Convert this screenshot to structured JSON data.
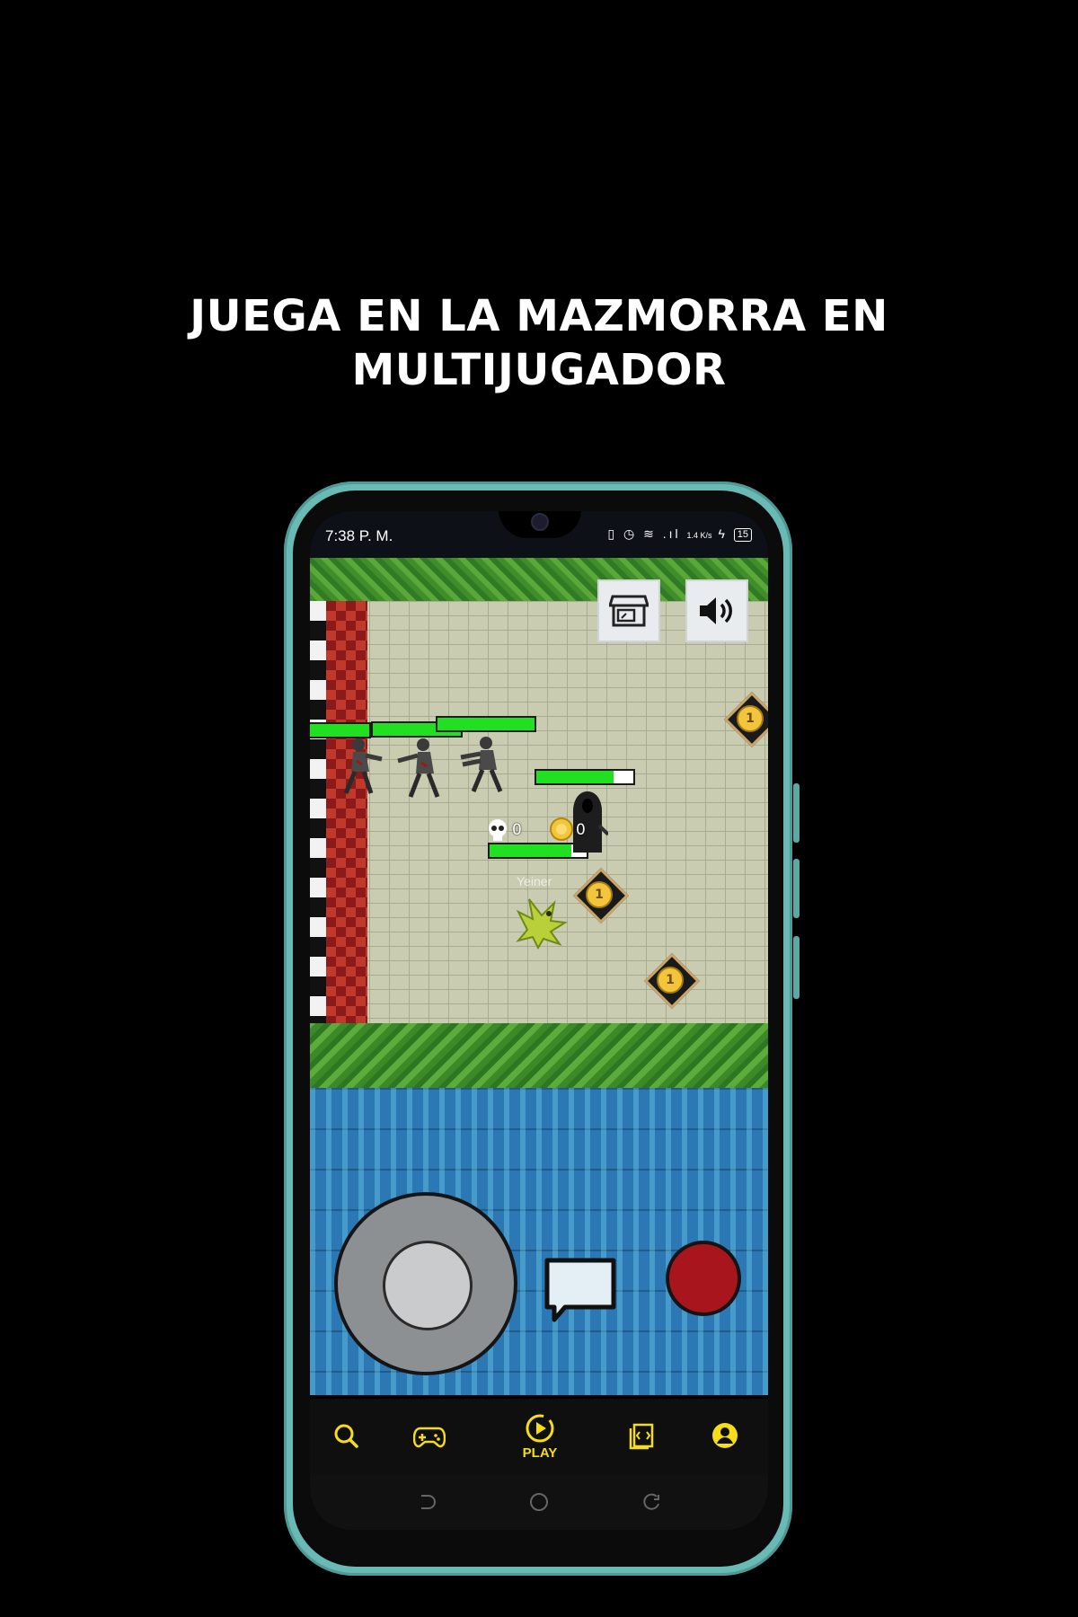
{
  "headline": {
    "line1": "JUEGA EN LA MAZMORRA EN",
    "line2": "MULTIJUGADOR"
  },
  "status_bar": {
    "time": "7:38 P. M.",
    "speed": "1.4 K/s",
    "battery": "15"
  },
  "game": {
    "buttons": {
      "shop_icon": "shop-icon",
      "sound_icon": "speaker-icon"
    },
    "hud_counters": {
      "kills": "0",
      "coins": "0"
    },
    "player_name": "Yeiner",
    "coin_label": "1",
    "health": {
      "zombie_1": 1.0,
      "zombie_2": 1.0,
      "zombie_3": 1.0,
      "reaper": 0.8,
      "player": 0.84
    }
  },
  "nav": {
    "items": [
      {
        "icon": "search-icon",
        "label": ""
      },
      {
        "icon": "gamepad-icon",
        "label": ""
      },
      {
        "icon": "play-icon",
        "label": "PLAY"
      },
      {
        "icon": "code-file-icon",
        "label": ""
      },
      {
        "icon": "user-icon",
        "label": ""
      }
    ]
  },
  "colors": {
    "accent": "#f6dd1a",
    "frame": "#69b9b4",
    "attack": "#a8151c",
    "health": "#21e021"
  }
}
